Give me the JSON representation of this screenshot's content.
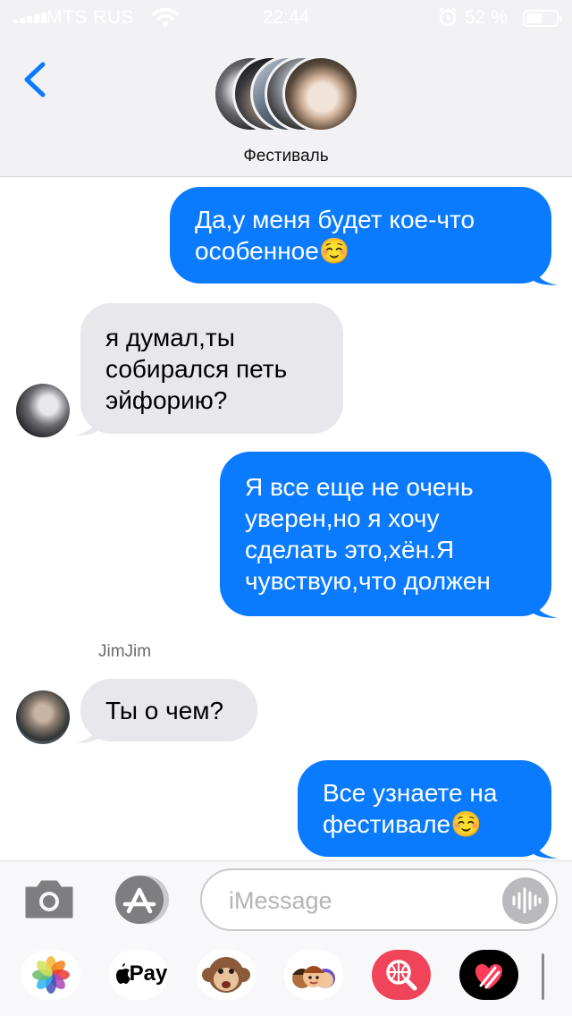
{
  "status_bar": {
    "carrier": "MTS RUS",
    "time": "22:44",
    "battery_percent": "52 %",
    "battery_level": 0.52
  },
  "header": {
    "group_name": "Фестиваль",
    "back_icon": "chevron-left-icon"
  },
  "messages": [
    {
      "direction": "outgoing",
      "lines": [
        "Да,у меня будет кое-что",
        "особенное☺️"
      ]
    },
    {
      "direction": "incoming",
      "lines": [
        "я думал,ты",
        "собирался петь",
        "эйфорию?"
      ]
    },
    {
      "direction": "outgoing",
      "lines": [
        "Я все еще не очень",
        "уверен,но я хочу",
        "сделать это,хён.Я",
        "чувствую,что должен"
      ]
    },
    {
      "direction": "incoming",
      "sender": "JimJim",
      "lines": [
        "Ты о чем?"
      ]
    },
    {
      "direction": "outgoing",
      "lines": [
        "Все узнаете на",
        "фестивале☺️"
      ]
    }
  ],
  "input_bar": {
    "placeholder": "iMessage",
    "camera_icon": "camera-icon",
    "appstore_icon": "app-store-icon",
    "audio_icon": "audio-waveform-icon"
  },
  "app_drawer": {
    "apps": [
      {
        "name": "Photos",
        "icon": "photos-icon"
      },
      {
        "name": "Apple Pay",
        "label": "Pay",
        "icon": "apple-pay-icon"
      },
      {
        "name": "Animoji",
        "icon": "monkey-animoji-icon"
      },
      {
        "name": "Memoji",
        "icon": "memoji-stickers-icon"
      },
      {
        "name": "Search",
        "icon": "web-search-icon"
      },
      {
        "name": "Digital Touch",
        "icon": "digital-touch-heart-icon"
      }
    ]
  },
  "colors": {
    "outgoing_bubble": "#0a7bff",
    "incoming_bubble": "#e8e8ec",
    "accent": "#0a7bff",
    "header_background": "#f2f2f4"
  }
}
